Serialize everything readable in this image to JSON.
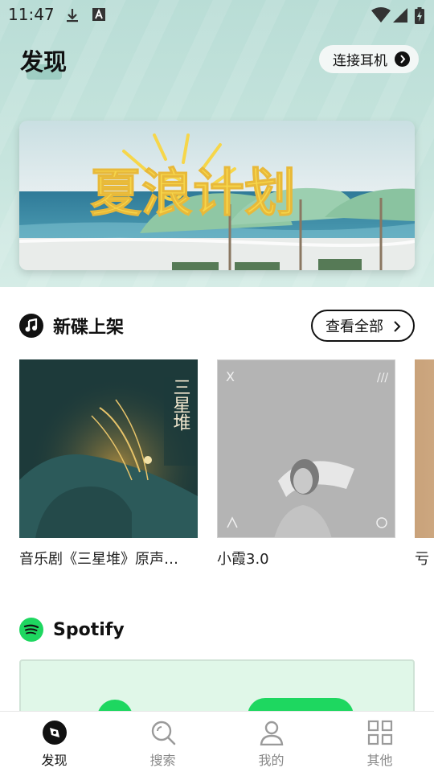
{
  "status_bar": {
    "time": "11:47",
    "icons": [
      "download-icon",
      "a-box-icon",
      "wifi-icon",
      "signal-icon",
      "battery-charging-icon"
    ]
  },
  "header": {
    "title": "发现",
    "connect_label": "连接耳机"
  },
  "banner": {
    "headline": "夏浪计划",
    "image_desc": "beach-umbrellas-photo"
  },
  "new_releases": {
    "title": "新碟上架",
    "view_all_label": "查看全部",
    "albums": [
      {
        "title": "音乐剧《三星堆》原声…",
        "cover_text": "三星堆"
      },
      {
        "title": "小霞3.0"
      },
      {
        "title": "亏"
      }
    ]
  },
  "spotify": {
    "title": "Spotify"
  },
  "nav": {
    "items": [
      {
        "label": "发现",
        "icon": "discover-icon",
        "active": true
      },
      {
        "label": "搜索",
        "icon": "search-icon",
        "active": false
      },
      {
        "label": "我的",
        "icon": "profile-icon",
        "active": false
      },
      {
        "label": "其他",
        "icon": "grid-icon",
        "active": false
      }
    ]
  },
  "colors": {
    "header_bg": "#c3e2db",
    "spotify_green": "#1ed760",
    "accent_dark": "#111111"
  }
}
